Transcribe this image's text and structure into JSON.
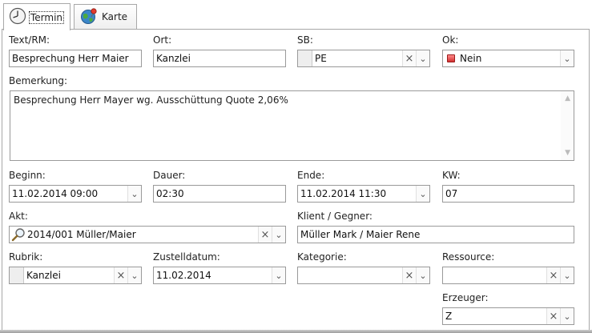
{
  "tabs": [
    {
      "label": "Termin",
      "icon": "clock-icon"
    },
    {
      "label": "Karte",
      "icon": "globe-icon"
    }
  ],
  "form": {
    "text_rm": {
      "label": "Text/RM:",
      "value": "Besprechung Herr Maier"
    },
    "ort": {
      "label": "Ort:",
      "value": "Kanzlei"
    },
    "sb": {
      "label": "SB:",
      "value": "PE"
    },
    "ok": {
      "label": "Ok:",
      "value": "Nein"
    },
    "bemerkung": {
      "label": "Bemerkung:",
      "value": "Besprechung Herr Mayer wg. Ausschüttung Quote 2,06%"
    },
    "beginn": {
      "label": "Beginn:",
      "value": "11.02.2014 09:00"
    },
    "dauer": {
      "label": "Dauer:",
      "value": "02:30"
    },
    "ende": {
      "label": "Ende:",
      "value": "11.02.2014 11:30"
    },
    "kw": {
      "label": "KW:",
      "value": "07"
    },
    "akt": {
      "label": "Akt:",
      "value": "2014/001 Müller/Maier"
    },
    "klient": {
      "label": "Klient / Gegner:",
      "value": "Müller Mark / Maier Rene"
    },
    "rubrik": {
      "label": "Rubrik:",
      "value": "Kanzlei"
    },
    "zustelldatum": {
      "label": "Zustelldatum:",
      "value": "11.02.2014"
    },
    "kategorie": {
      "label": "Kategorie:",
      "value": ""
    },
    "ressource": {
      "label": "Ressource:",
      "value": ""
    },
    "erzeuger": {
      "label": "Erzeuger:",
      "value": "Z"
    }
  },
  "icons": {
    "clear": "×",
    "dropdown": "⌄"
  },
  "colors": {
    "ok_indicator": "#d23030",
    "border": "#9a9a9a"
  }
}
